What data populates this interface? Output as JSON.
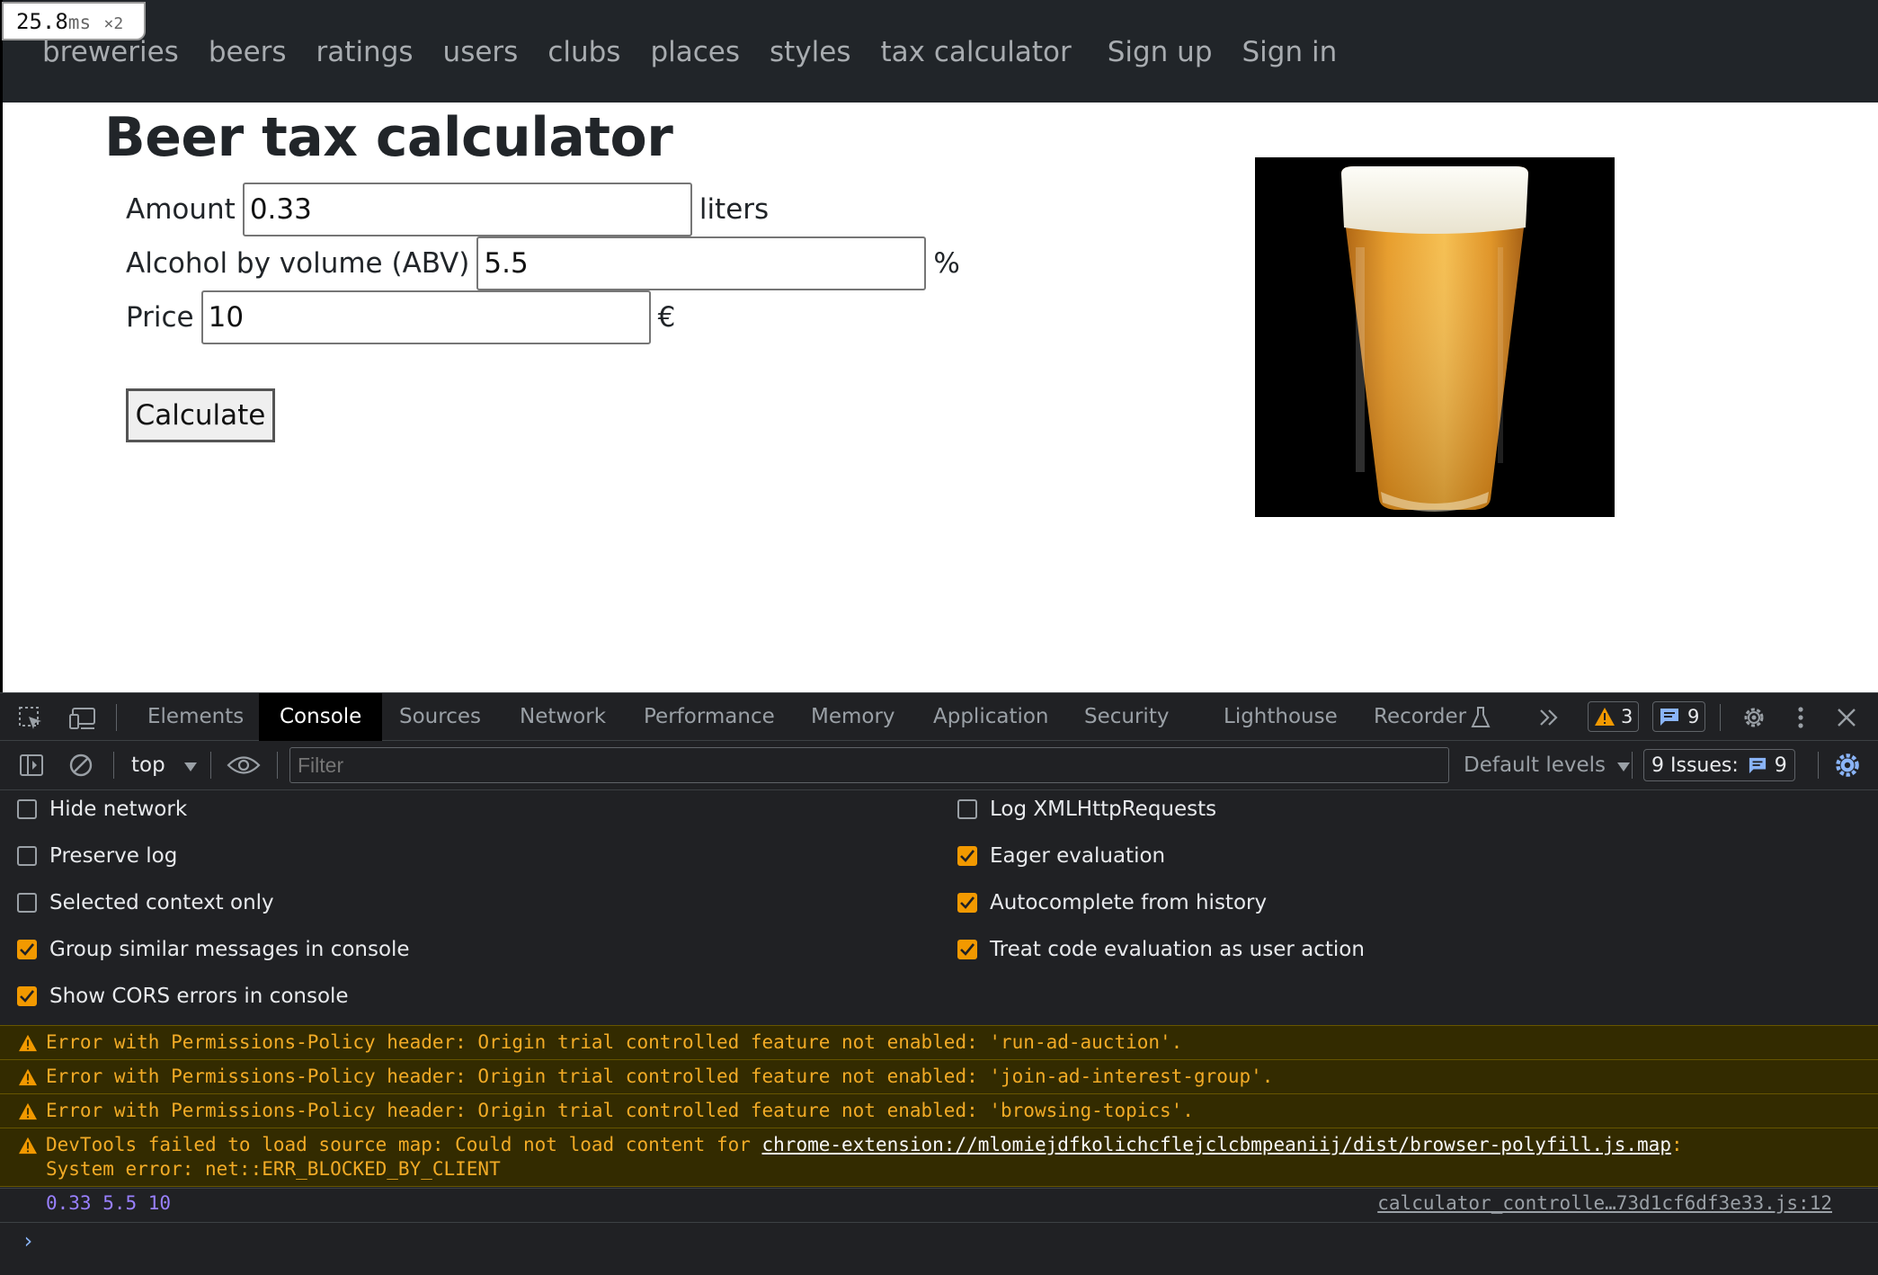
{
  "timer": {
    "value": "25.8",
    "unit": "ms",
    "multiplier": "×2"
  },
  "nav": {
    "links": [
      "breweries",
      "beers",
      "ratings",
      "users",
      "clubs",
      "places",
      "styles",
      "tax calculator",
      "Sign up",
      "Sign in"
    ]
  },
  "page": {
    "title": "Beer tax calculator",
    "amount": {
      "label": "Amount",
      "value": "0.33",
      "unit": "liters"
    },
    "abv": {
      "label": "Alcohol by volume (ABV)",
      "value": "5.5",
      "unit": "%"
    },
    "price": {
      "label": "Price",
      "value": "10",
      "unit": "€"
    },
    "calculate_label": "Calculate"
  },
  "devtools": {
    "tabs": [
      "Elements",
      "Console",
      "Sources",
      "Network",
      "Performance",
      "Memory",
      "Application",
      "Security",
      "Lighthouse",
      "Recorder"
    ],
    "active_tab": "Console",
    "warnings_count": "3",
    "messages_count": "9",
    "context": "top",
    "filter_placeholder": "Filter",
    "levels_label": "Default levels",
    "issues_label": "9 Issues:",
    "issues_count": "9",
    "settings": {
      "left": [
        {
          "label": "Hide network",
          "checked": false
        },
        {
          "label": "Preserve log",
          "checked": false
        },
        {
          "label": "Selected context only",
          "checked": false
        },
        {
          "label": "Group similar messages in console",
          "checked": true
        },
        {
          "label": "Show CORS errors in console",
          "checked": true
        }
      ],
      "right": [
        {
          "label": "Log XMLHttpRequests",
          "checked": false
        },
        {
          "label": "Eager evaluation",
          "checked": true
        },
        {
          "label": "Autocomplete from history",
          "checked": true
        },
        {
          "label": "Treat code evaluation as user action",
          "checked": true
        }
      ]
    },
    "messages": [
      "Error with Permissions-Policy header: Origin trial controlled feature not enabled: 'run-ad-auction'.",
      "Error with Permissions-Policy header: Origin trial controlled feature not enabled: 'join-ad-interest-group'.",
      "Error with Permissions-Policy header: Origin trial controlled feature not enabled: 'browsing-topics'."
    ],
    "sourcemap_msg": {
      "prefix": "DevTools failed to load source map: Could not load content for ",
      "link": "chrome-extension://mlomiejdfkolichcflejclcbmpeaniij/dist/browser-polyfill.js.map",
      "suffix": ":",
      "line2": "System error: net::ERR_BLOCKED_BY_CLIENT"
    },
    "log": {
      "values": "0.33 5.5 10",
      "source": "calculator_controlle…73d1cf6df3e33.js:12"
    },
    "prompt": "›",
    "colors": {
      "warning": "#f2ab26",
      "accent": "#8ab4f8",
      "checkbox": "#f29900"
    }
  }
}
